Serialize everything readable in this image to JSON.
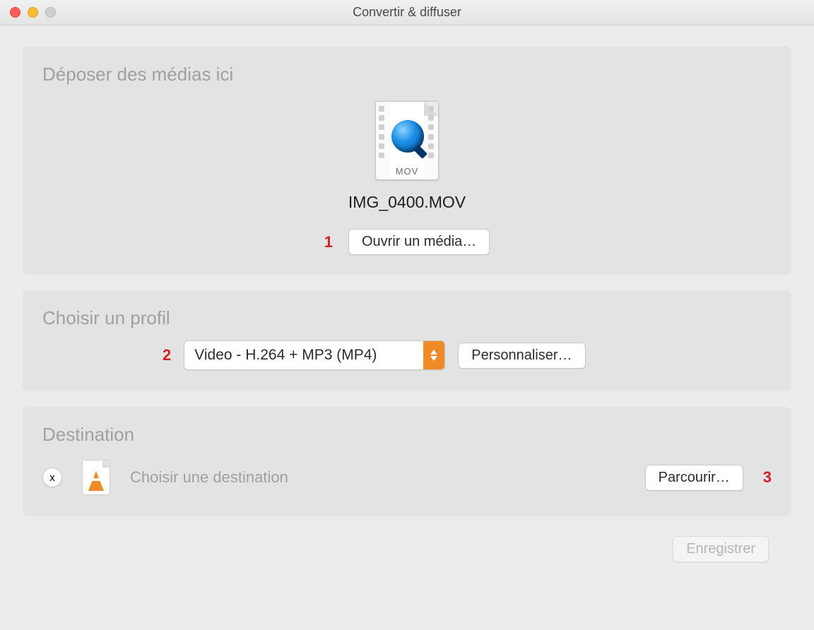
{
  "window": {
    "title": "Convertir & diffuser"
  },
  "drop": {
    "heading": "Déposer des médias ici",
    "file_ext_label": "MOV",
    "filename": "IMG_0400.MOV",
    "open_button": "Ouvrir un média…"
  },
  "profile": {
    "heading": "Choisir un profil",
    "selected": "Video - H.264 + MP3 (MP4)",
    "customize_button": "Personnaliser…"
  },
  "destination": {
    "heading": "Destination",
    "clear_label": "x",
    "placeholder": "Choisir une destination",
    "browse_button": "Parcourir…"
  },
  "footer": {
    "save_button": "Enregistrer"
  },
  "annotations": {
    "one": "1",
    "two": "2",
    "three": "3"
  }
}
